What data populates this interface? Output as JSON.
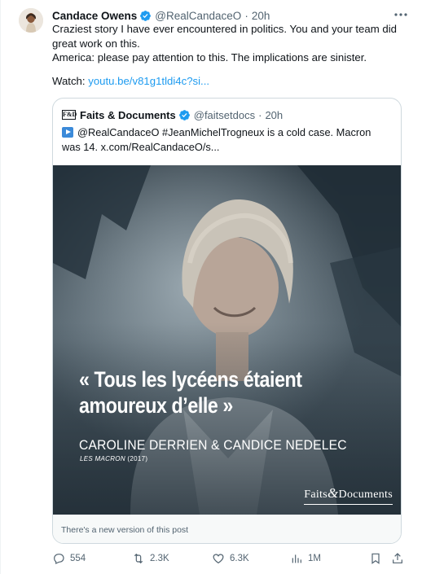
{
  "author": {
    "name": "Candace Owens",
    "handle": "@RealCandaceO",
    "separator": "·",
    "time": "20h"
  },
  "more_icon": "more-icon",
  "text": {
    "line1": "Craziest story I have ever encountered in politics. You and your team did great work on this.",
    "line2": "America: please pay attention to this. The implications are sinister.",
    "watch_label": "Watch: ",
    "watch_link": "youtu.be/v81g1tldi4c?si..."
  },
  "quoted": {
    "logo_text": "F&D",
    "name": "Faits & Documents",
    "handle": "@faitsetdocs",
    "separator": "·",
    "time": "20h",
    "text": "@RealCandaceO #JeanMichelTrogneux is a cold case. Macron was 14. x.com/RealCandaceO/s...",
    "image": {
      "quote_line1": "« Tous les lycéens étaient",
      "quote_line2": "amoureux d’elle »",
      "authors": "CAROLINE DERRIEN & CANDICE NEDELEC",
      "source_title": "LES MACRON",
      "source_year": " (2017)",
      "watermark_a": "Faits",
      "watermark_amp": "&",
      "watermark_b": "Documents"
    },
    "version_notice": "There's a new version of this post"
  },
  "actions": {
    "replies": "554",
    "reposts": "2.3K",
    "likes": "6.3K",
    "views": "1M"
  },
  "colors": {
    "accent": "#1d9bf0",
    "muted": "#536471",
    "text": "#0f1419",
    "repost_green": "#536471"
  }
}
